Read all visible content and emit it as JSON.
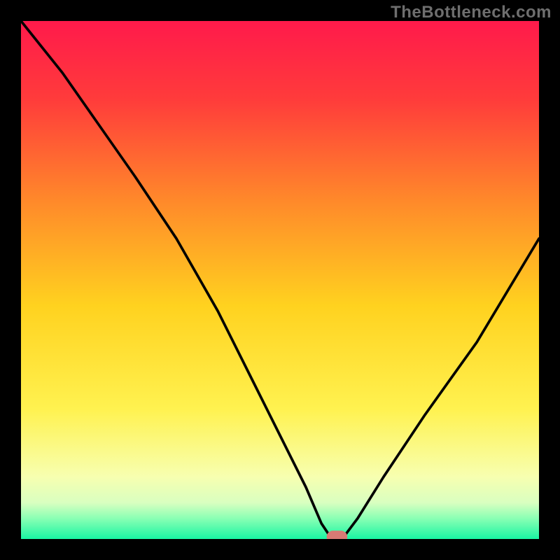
{
  "watermark": "TheBottleneck.com",
  "chart_data": {
    "type": "line",
    "title": "",
    "xlabel": "",
    "ylabel": "",
    "xlim": [
      0,
      100
    ],
    "ylim": [
      0,
      100
    ],
    "x": [
      0,
      8,
      15,
      22,
      30,
      38,
      45,
      50,
      55,
      58,
      60,
      62,
      65,
      70,
      78,
      88,
      100
    ],
    "values": [
      100,
      90,
      80,
      70,
      58,
      44,
      30,
      20,
      10,
      3,
      0,
      0,
      4,
      12,
      24,
      38,
      58
    ],
    "minimum_marker": {
      "x": 61,
      "y": 0
    },
    "background_gradient": {
      "orientation": "vertical",
      "stops": [
        {
          "pos": 0.0,
          "color": "#ff1a4b"
        },
        {
          "pos": 0.15,
          "color": "#ff3b3b"
        },
        {
          "pos": 0.35,
          "color": "#ff8a2a"
        },
        {
          "pos": 0.55,
          "color": "#ffd21f"
        },
        {
          "pos": 0.75,
          "color": "#fff250"
        },
        {
          "pos": 0.88,
          "color": "#f7ffb0"
        },
        {
          "pos": 0.93,
          "color": "#d9ffc0"
        },
        {
          "pos": 0.96,
          "color": "#8affb4"
        },
        {
          "pos": 1.0,
          "color": "#19f5a3"
        }
      ]
    },
    "marker_color": "#d87a74",
    "curve_color": "#000000"
  }
}
